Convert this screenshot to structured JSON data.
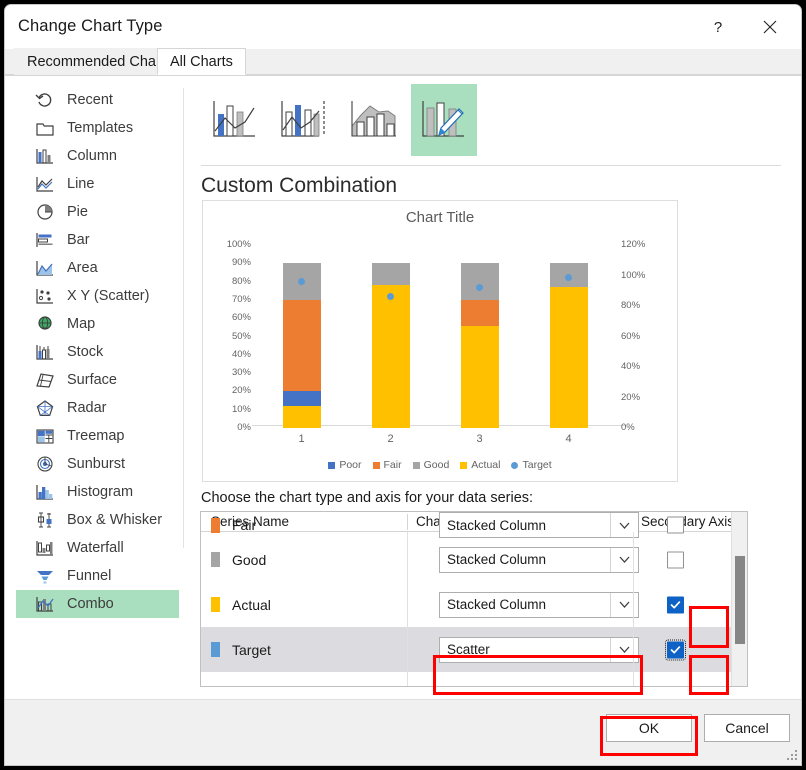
{
  "window": {
    "title": "Change Chart Type",
    "help_glyph": "?",
    "close_glyph": "✕"
  },
  "tabs": [
    {
      "label": "Recommended Charts",
      "active": false
    },
    {
      "label": "All Charts",
      "active": true
    }
  ],
  "chart_types": [
    {
      "label": "Recent",
      "icon": "recent-icon",
      "selected": false
    },
    {
      "label": "Templates",
      "icon": "templates-icon",
      "selected": false
    },
    {
      "label": "Column",
      "icon": "column-icon",
      "selected": false
    },
    {
      "label": "Line",
      "icon": "line-icon",
      "selected": false
    },
    {
      "label": "Pie",
      "icon": "pie-icon",
      "selected": false
    },
    {
      "label": "Bar",
      "icon": "bar-icon",
      "selected": false
    },
    {
      "label": "Area",
      "icon": "area-icon",
      "selected": false
    },
    {
      "label": "X Y (Scatter)",
      "icon": "scatter-icon",
      "selected": false
    },
    {
      "label": "Map",
      "icon": "map-icon",
      "selected": false
    },
    {
      "label": "Stock",
      "icon": "stock-icon",
      "selected": false
    },
    {
      "label": "Surface",
      "icon": "surface-icon",
      "selected": false
    },
    {
      "label": "Radar",
      "icon": "radar-icon",
      "selected": false
    },
    {
      "label": "Treemap",
      "icon": "treemap-icon",
      "selected": false
    },
    {
      "label": "Sunburst",
      "icon": "sunburst-icon",
      "selected": false
    },
    {
      "label": "Histogram",
      "icon": "histogram-icon",
      "selected": false
    },
    {
      "label": "Box & Whisker",
      "icon": "box-whisker-icon",
      "selected": false
    },
    {
      "label": "Waterfall",
      "icon": "waterfall-icon",
      "selected": false
    },
    {
      "label": "Funnel",
      "icon": "funnel-icon",
      "selected": false
    },
    {
      "label": "Combo",
      "icon": "combo-icon",
      "selected": true
    }
  ],
  "gallery": [
    {
      "name": "clustered-column-line",
      "selected": false
    },
    {
      "name": "clustered-column-line-on-secondary-axis",
      "selected": false
    },
    {
      "name": "stacked-area-clustered-column",
      "selected": false
    },
    {
      "name": "custom-combination",
      "selected": true
    }
  ],
  "variant_title": "Custom Combination",
  "chart_data": {
    "type": "bar",
    "title": "Chart Title",
    "subtitle": "",
    "xlabel": "",
    "ylabel": "",
    "categories": [
      "1",
      "2",
      "3",
      "4"
    ],
    "stacked": true,
    "grid": false,
    "legend_position": "bottom",
    "primary_axis": {
      "ticks": [
        "100%",
        "90%",
        "80%",
        "70%",
        "60%",
        "50%",
        "40%",
        "30%",
        "20%",
        "10%",
        "0%"
      ],
      "min": 0,
      "max": 100
    },
    "secondary_axis": {
      "ticks": [
        "120%",
        "100%",
        "80%",
        "60%",
        "40%",
        "20%",
        "0%"
      ],
      "min": 0,
      "max": 120
    },
    "series": [
      {
        "name": "Poor",
        "color": "#4472C4",
        "type": "Stacked Column",
        "axis": "primary",
        "values": [
          8,
          0,
          0,
          0
        ]
      },
      {
        "name": "Fair",
        "color": "#ED7D31",
        "type": "Stacked Column",
        "axis": "primary",
        "values": [
          50,
          0,
          14,
          0
        ]
      },
      {
        "name": "Good",
        "color": "#A5A5A5",
        "type": "Stacked Column",
        "axis": "primary",
        "values": [
          20,
          12,
          20,
          13
        ]
      },
      {
        "name": "Actual",
        "color": "#FFC000",
        "type": "Stacked Column",
        "axis": "secondary",
        "values": [
          12,
          78,
          56,
          77
        ]
      },
      {
        "name": "Target",
        "color": "#5B9BD5",
        "type": "Scatter",
        "axis": "secondary",
        "values": [
          80,
          72,
          77,
          82
        ]
      }
    ],
    "legend": [
      "Poor",
      "Fair",
      "Good",
      "Actual",
      "Target"
    ]
  },
  "series_section": {
    "instruction": "Choose the chart type and axis for your data series:",
    "headers": {
      "name": "Series Name",
      "type": "Chart Type",
      "axis": "Secondary Axis"
    },
    "rows": [
      {
        "name": "Fair",
        "color": "#ED7D31",
        "chart_type": "Stacked Column",
        "secondary_axis": false,
        "selected": false,
        "clipped": true
      },
      {
        "name": "Good",
        "color": "#A5A5A5",
        "chart_type": "Stacked Column",
        "secondary_axis": false,
        "selected": false,
        "clipped": false
      },
      {
        "name": "Actual",
        "color": "#FFC000",
        "chart_type": "Stacked Column",
        "secondary_axis": true,
        "selected": false,
        "clipped": false
      },
      {
        "name": "Target",
        "color": "#5B9BD5",
        "chart_type": "Scatter",
        "secondary_axis": true,
        "selected": true,
        "clipped": false
      }
    ]
  },
  "footer": {
    "ok_label": "OK",
    "cancel_label": "Cancel"
  },
  "annotations": {
    "highlight_color": "#FF0000",
    "boxes": [
      "actual-secondary-axis-checkbox",
      "target-chart-type-select",
      "target-secondary-axis-checkbox",
      "ok-button"
    ]
  }
}
